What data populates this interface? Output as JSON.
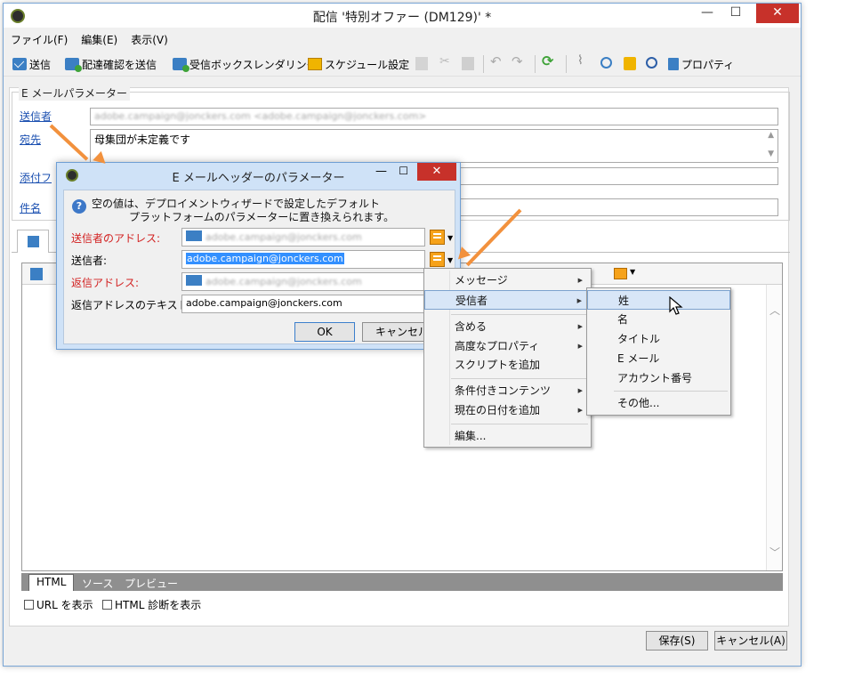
{
  "window": {
    "title": "配信 '特別オファー (DM129)' *",
    "minimize": "—",
    "maximize": "☐",
    "close": "✕"
  },
  "menubar": [
    "ファイル(F)",
    "編集(E)",
    "表示(V)"
  ],
  "toolbar": {
    "send": "送信",
    "send_proof": "配達確認を送信",
    "inbox_rendering": "受信ボックスレンダリング",
    "schedule": "スケジュール設定",
    "properties": "プロパティ"
  },
  "email_params": {
    "legend": "E メールパラメーター",
    "sender_label": "送信者",
    "sender_value": "adobe.campaign@jonckers.com <adobe.campaign@jonckers.com>",
    "recipient_label": "宛先",
    "recipient_value": "母集団が未定義です",
    "attachment_label": "添付フ",
    "subject_label": "件名"
  },
  "view_tabs": [
    "HTML",
    "ソース",
    "プレビュー"
  ],
  "checkboxes": {
    "show_urls": "URL を表示",
    "html_diagnostics": "HTML 診断を表示"
  },
  "footer": {
    "save": "保存(S)",
    "cancel": "キャンセル(A)"
  },
  "dialog": {
    "title": "E メールヘッダーのパラメーター",
    "info_line1": "空の値は、デプロイメントウィザードで設定したデフォルト",
    "info_line2": "プラットフォームのパラメーターに置き換えられます。",
    "sender_address_label": "送信者のアドレス:",
    "sender_address_value": "adobe.campaign@jonckers.com",
    "sender_label": "送信者:",
    "sender_value": "adobe.campaign@jonckers.com",
    "reply_address_label": "返信アドレス:",
    "reply_address_value": "adobe.campaign@jonckers.com",
    "reply_text_label": "返信アドレスのテキスト:",
    "reply_text_value": "adobe.campaign@jonckers.com",
    "ok": "OK",
    "cancel": "キャンセル"
  },
  "context_menu": {
    "items": [
      "メッセージ",
      "受信者",
      "含める",
      "高度なプロパティ",
      "スクリプトを追加",
      "条件付きコンテンツ",
      "現在の日付を追加",
      "編集..."
    ]
  },
  "submenu": {
    "items": [
      "姓",
      "名",
      "タイトル",
      "E メール",
      "アカウント番号",
      "その他..."
    ]
  },
  "colors": {
    "accent_arrow": "#f2913d",
    "close_red": "#c7312a",
    "required_red": "#d21e1e",
    "link_blue": "#1a4fb0"
  }
}
